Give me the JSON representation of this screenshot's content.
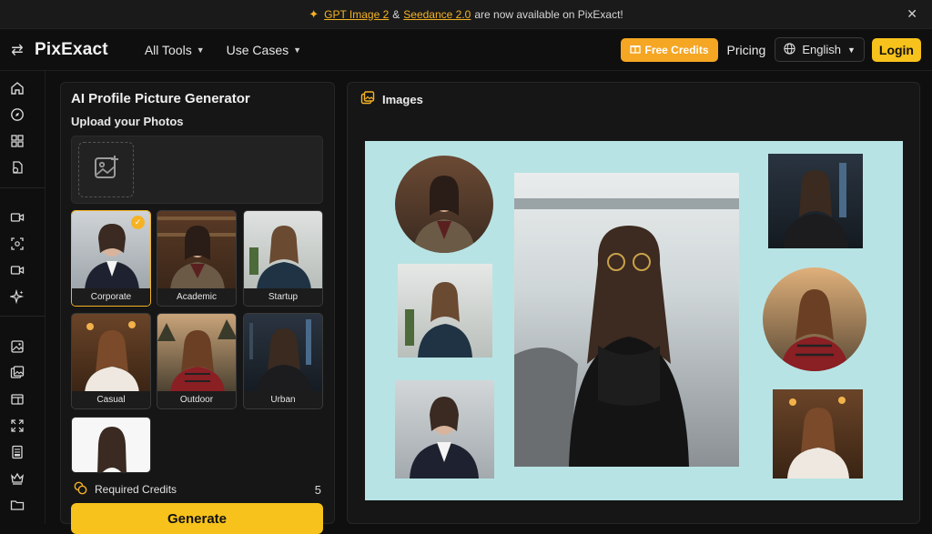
{
  "announcement": {
    "link1": "GPT Image 2",
    "amp": "&",
    "link2": "Seedance 2.0",
    "rest": "are now available on PixExact!"
  },
  "nav": {
    "brand": "PixExact",
    "all_tools": "All Tools",
    "use_cases": "Use Cases",
    "free_credits": "Free Credits",
    "pricing": "Pricing",
    "language": "English",
    "login": "Login"
  },
  "panel": {
    "title": "AI Profile Picture Generator",
    "upload_label": "Upload your Photos",
    "styles": [
      {
        "label": "Corporate",
        "selected": true
      },
      {
        "label": "Academic",
        "selected": false
      },
      {
        "label": "Startup",
        "selected": false
      },
      {
        "label": "Casual",
        "selected": false
      },
      {
        "label": "Outdoor",
        "selected": false
      },
      {
        "label": "Urban",
        "selected": false
      },
      {
        "label": "",
        "selected": false
      }
    ],
    "required_credits_label": "Required Credits",
    "required_credits_value": "5",
    "generate": "Generate"
  },
  "images": {
    "title": "Images"
  },
  "colors": {
    "accent": "#f7c21b",
    "credits_button": "#f5a623",
    "collage_bg": "#b8e3e4"
  }
}
